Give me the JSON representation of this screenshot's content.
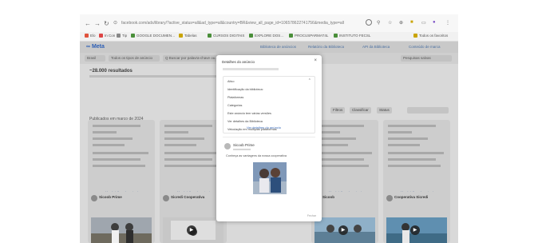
{
  "browser": {
    "address": "facebook.com/ads/library/?active_status=all&ad_type=all&country=BR&view_all_page_id=106578622741756&media_type=all",
    "bookmarks": [
      "Elo",
      "In Con",
      "Tip",
      "GOOGLE DOCUMEN…",
      "Tabelas",
      "CURSOS DIGITAIS",
      "EXPLORE DOS…",
      "PROCUSPARMAT4L",
      "INSTITUTO FECSL"
    ],
    "bookmarks_end": "Todos os favoritos"
  },
  "app": {
    "logo": "Meta",
    "top_links": [
      "Biblioteca de anúncios",
      "Relatório da Biblioteca",
      "API da Biblioteca",
      "Conteúdo de marca"
    ],
    "search_pills": [
      "Brasil",
      "Todos os tipos de anúncio",
      "Q  Buscar por palavra-chave ou anunciante"
    ],
    "saved_label": "Pesquisas salvas",
    "results_title": "~28.000 resultados",
    "section_title": "Publicados em março de 2024",
    "filter_controls": [
      "Filtros",
      "Classificar",
      "Status"
    ],
    "card_link": "Ver detalhes do anúncio",
    "bottom_cards": [
      {
        "name": "Sicoob Prime"
      },
      {
        "name": "Sicredi Cooperativa"
      },
      {
        "name": "Sicoob"
      },
      {
        "name": "Cooperativa Sicredi"
      }
    ]
  },
  "modal": {
    "title": "Detalhes do anúncio",
    "close": "×",
    "rows": [
      "Ativo",
      "Identificação da biblioteca:",
      "Plataformas",
      "Categorias",
      "Este anúncio tem várias versões",
      "Ver detalhes da Biblioteca",
      "Veiculação em múltiplas plataformas"
    ],
    "link": "Ver detalhes do anúncio",
    "post_name": "Sicoob Prime",
    "post_text": "Conheça as vantagens da nossa cooperativa",
    "footer": "Fechar"
  },
  "colors": {
    "accent": "#3b6bb8",
    "app_background": "#d9d9d9",
    "modal_background": "#ffffff"
  }
}
